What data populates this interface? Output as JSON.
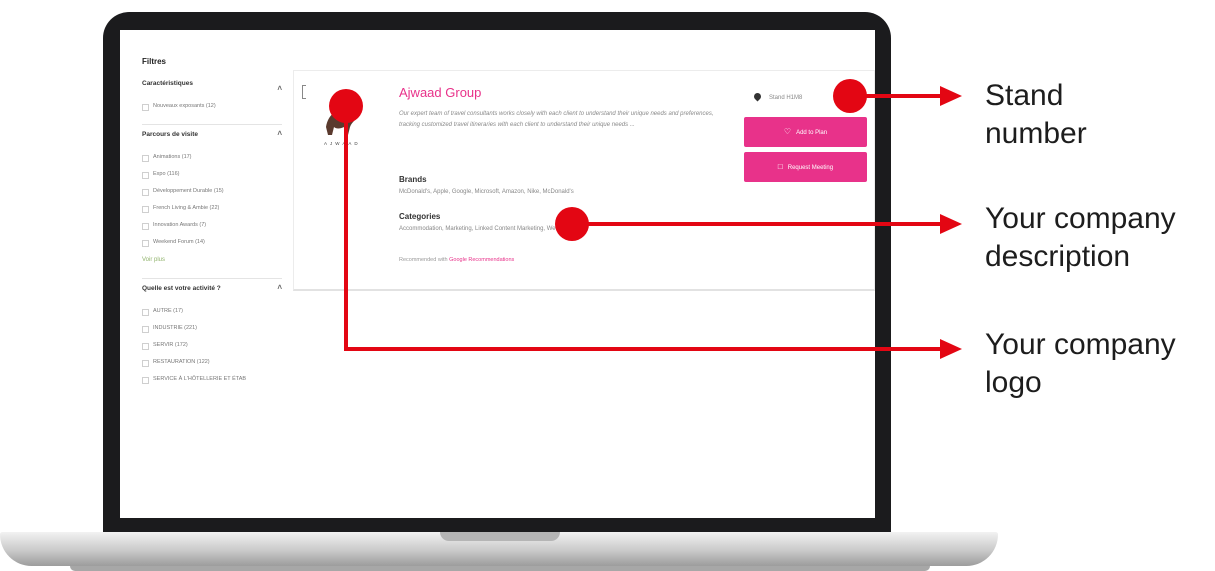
{
  "filters": {
    "title": "Filtres",
    "groups": [
      {
        "heading": "Caractéristiques",
        "items": [
          "Nouveaux exposants (12)"
        ],
        "show_more": ""
      },
      {
        "heading": "Parcours de visite",
        "items": [
          "Animations (17)",
          "Expo (116)",
          "Développement Durable (15)",
          "French Living & Ambie (22)",
          "Innovation Awards (7)",
          "Weekend Forum (14)"
        ],
        "show_more": "Voir plus"
      },
      {
        "heading": "Quelle est votre activité ?",
        "items": [
          "AUTRE (17)",
          "INDUSTRIE (221)",
          "SERVIR (172)",
          "RESTAURATION (122)",
          "SERVICE À L'HÔTELLERIE ET ÉTAB"
        ],
        "show_more": ""
      }
    ]
  },
  "exhibitor": {
    "name": "Ajwaad Group",
    "description": "Our expert team of travel consultants works closely with each client to understand their unique needs and preferences, tracking customized travel itineraries with each client to understand their unique needs ...",
    "brands_label": "Brands",
    "brands": "McDonald's, Apple, Google, Microsoft, Amazon, Nike, McDonald's",
    "categories_label": "Categories",
    "categories": "Accommodation, Marketing, Linked Content Marketing, Wellbeing",
    "featured_label": "Recommended with",
    "featured_link": "Google Recommendations",
    "logo_text": "AJWAAD",
    "stand": "Stand H1M8",
    "add_button": "Add to Plan",
    "meeting_button": "Request Meeting"
  },
  "callouts": {
    "stand_line1": "Stand",
    "stand_line2": "number",
    "desc_line1": "Your company",
    "desc_line2": "description",
    "logo_line1": "Your company",
    "logo_line2": "logo"
  },
  "colors": {
    "accent": "#e8328a",
    "callout_red": "#e30613",
    "laptop_frame": "#1b1b1d"
  },
  "icons": {
    "stand": "map-pin-icon",
    "add": "heart-icon",
    "meeting": "calendar-icon"
  }
}
